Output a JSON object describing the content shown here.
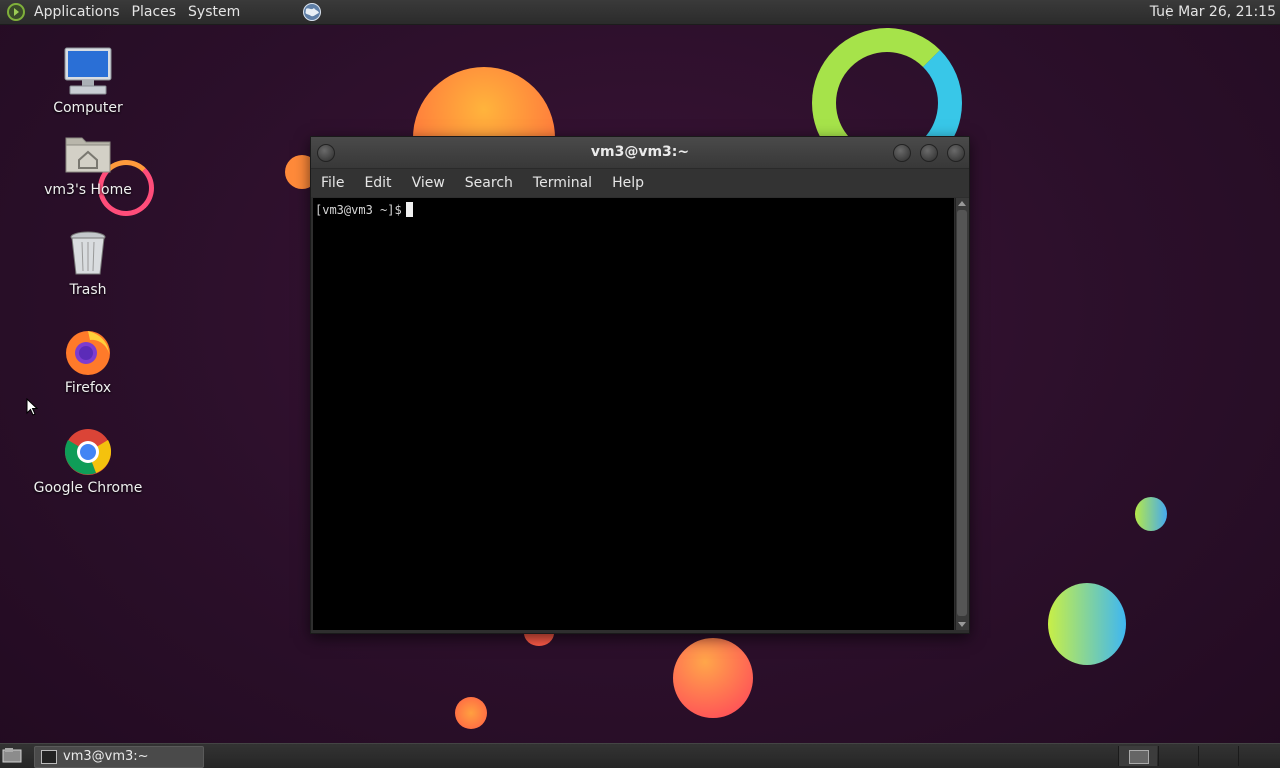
{
  "top_panel": {
    "menus": [
      "Applications",
      "Places",
      "System"
    ],
    "clock": "Tue Mar 26, 21:15",
    "icons": {
      "apps": "distro-logo-icon",
      "browser": "globe-icon"
    }
  },
  "desktop": {
    "icons": [
      {
        "label": "Computer",
        "icon": "computer-icon"
      },
      {
        "label": "vm3's Home",
        "icon": "home-folder-icon"
      },
      {
        "label": "Trash",
        "icon": "trash-icon"
      },
      {
        "label": "Firefox",
        "icon": "firefox-icon"
      },
      {
        "label": "Google Chrome",
        "icon": "chrome-icon"
      }
    ]
  },
  "terminal": {
    "title": "vm3@vm3:~",
    "menu": [
      "File",
      "Edit",
      "View",
      "Search",
      "Terminal",
      "Help"
    ],
    "prompt": "[vm3@vm3 ~]$"
  },
  "bottom_panel": {
    "task_label": "vm3@vm3:~",
    "icons": {
      "show_desktop": "show-desktop-icon",
      "task": "terminal-icon"
    }
  },
  "colors": {
    "panel_bg": "#2b2b2b",
    "desktop_bg": "#2a0f28",
    "terminal_bg": "#000000"
  }
}
